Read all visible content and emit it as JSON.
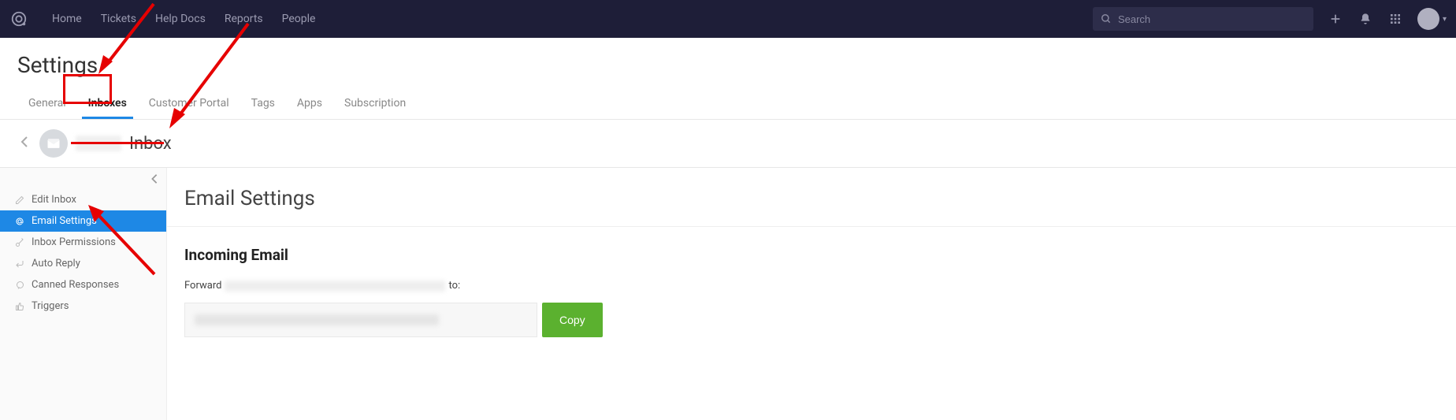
{
  "topnav": {
    "links": [
      "Home",
      "Tickets",
      "Help Docs",
      "Reports",
      "People"
    ],
    "search_placeholder": "Search"
  },
  "settings": {
    "title": "Settings",
    "tabs": [
      "General",
      "Inboxes",
      "Customer Portal",
      "Tags",
      "Apps",
      "Subscription"
    ],
    "active_tab": "Inboxes"
  },
  "inbox": {
    "name_suffix": "Inbox"
  },
  "sidebar": {
    "items": [
      {
        "label": "Edit Inbox",
        "icon": "pencil"
      },
      {
        "label": "Email Settings",
        "icon": "at"
      },
      {
        "label": "Inbox Permissions",
        "icon": "key"
      },
      {
        "label": "Auto Reply",
        "icon": "reply"
      },
      {
        "label": "Canned Responses",
        "icon": "chat"
      },
      {
        "label": "Triggers",
        "icon": "thumb"
      }
    ],
    "active": "Email Settings"
  },
  "main": {
    "title": "Email Settings",
    "incoming_title": "Incoming Email",
    "forward_prefix": "Forward",
    "forward_suffix": "to:",
    "copy_label": "Copy"
  }
}
